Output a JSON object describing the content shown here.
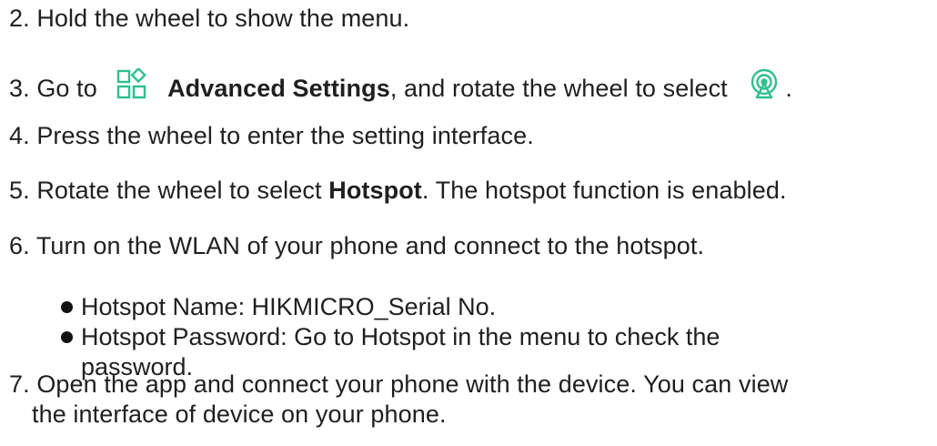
{
  "steps": {
    "s2": "2. Hold the wheel to show the menu.",
    "s3": {
      "before_icon": "3. Go to",
      "icon1": "advanced-settings-icon",
      "bold": "Advanced Settings",
      "after_bold": ", and rotate the wheel to select",
      "icon2": "hotspot-icon",
      "end": "."
    },
    "s4": "4. Press the wheel to enter the setting interface.",
    "s5": {
      "prefix": "5. Rotate the wheel to select ",
      "bold": "Hotspot",
      "suffix": ". The hotspot function is enabled."
    },
    "s6": "6. Turn on the WLAN of your phone and connect to the hotspot.",
    "s7": {
      "line1": "7. Open the app and connect your phone with the device. You can view",
      "line2": "the interface of device on your phone."
    }
  },
  "bullets": [
    {
      "text": "Hotspot Name: HIKMICRO_Serial No."
    },
    {
      "text": "Hotspot Password: Go to Hotspot in the menu to check the",
      "cont": "password."
    }
  ],
  "colors": {
    "icon_accent": "#2fbf8f",
    "text": "#1f1f1f"
  }
}
